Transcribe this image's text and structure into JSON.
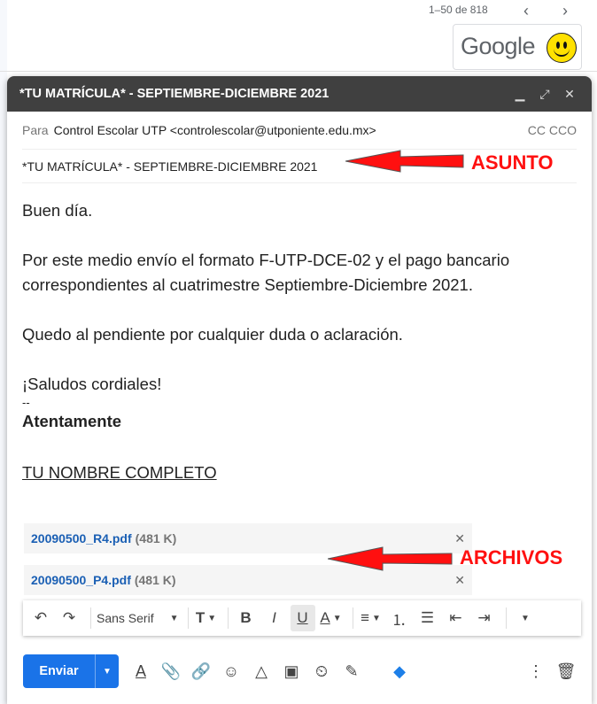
{
  "background": {
    "pager": "1–50 de 818",
    "logo_text": "Google"
  },
  "compose": {
    "title": "*TU MATRÍCULA* - SEPTIEMBRE-DICIEMBRE 2021",
    "to_label": "Para",
    "to_value": "Control Escolar UTP <controlescolar@utponiente.edu.mx>",
    "cc_label": "CC CCO",
    "subject": "*TU MATRÍCULA* - SEPTIEMBRE-DICIEMBRE 2021",
    "body": {
      "greeting": "Buen día.",
      "para1": "Por este medio envío el formato F-UTP-DCE-02  y el pago bancario correspondientes al cuatrimestre Septiembre-Diciembre 2021.",
      "para2": "Quedo al pendiente por cualquier duda o aclaración.",
      "para3": "¡Saludos cordiales!",
      "sig_dash": "--",
      "sig_bold": "Atentamente",
      "sig_name": "TU NOMBRE COMPLETO"
    },
    "attachments": [
      {
        "name": "20090500_R4.pdf",
        "size": "(481 K)"
      },
      {
        "name": "20090500_P4.pdf",
        "size": "(481 K)"
      }
    ],
    "format_font": "Sans Serif",
    "send_label": "Enviar"
  },
  "annotations": {
    "asunto": "ASUNTO",
    "archivos": "ARCHIVOS"
  },
  "colors": {
    "accent": "#1a73e8",
    "annotation": "#ff1010",
    "titlebar": "#404040"
  }
}
